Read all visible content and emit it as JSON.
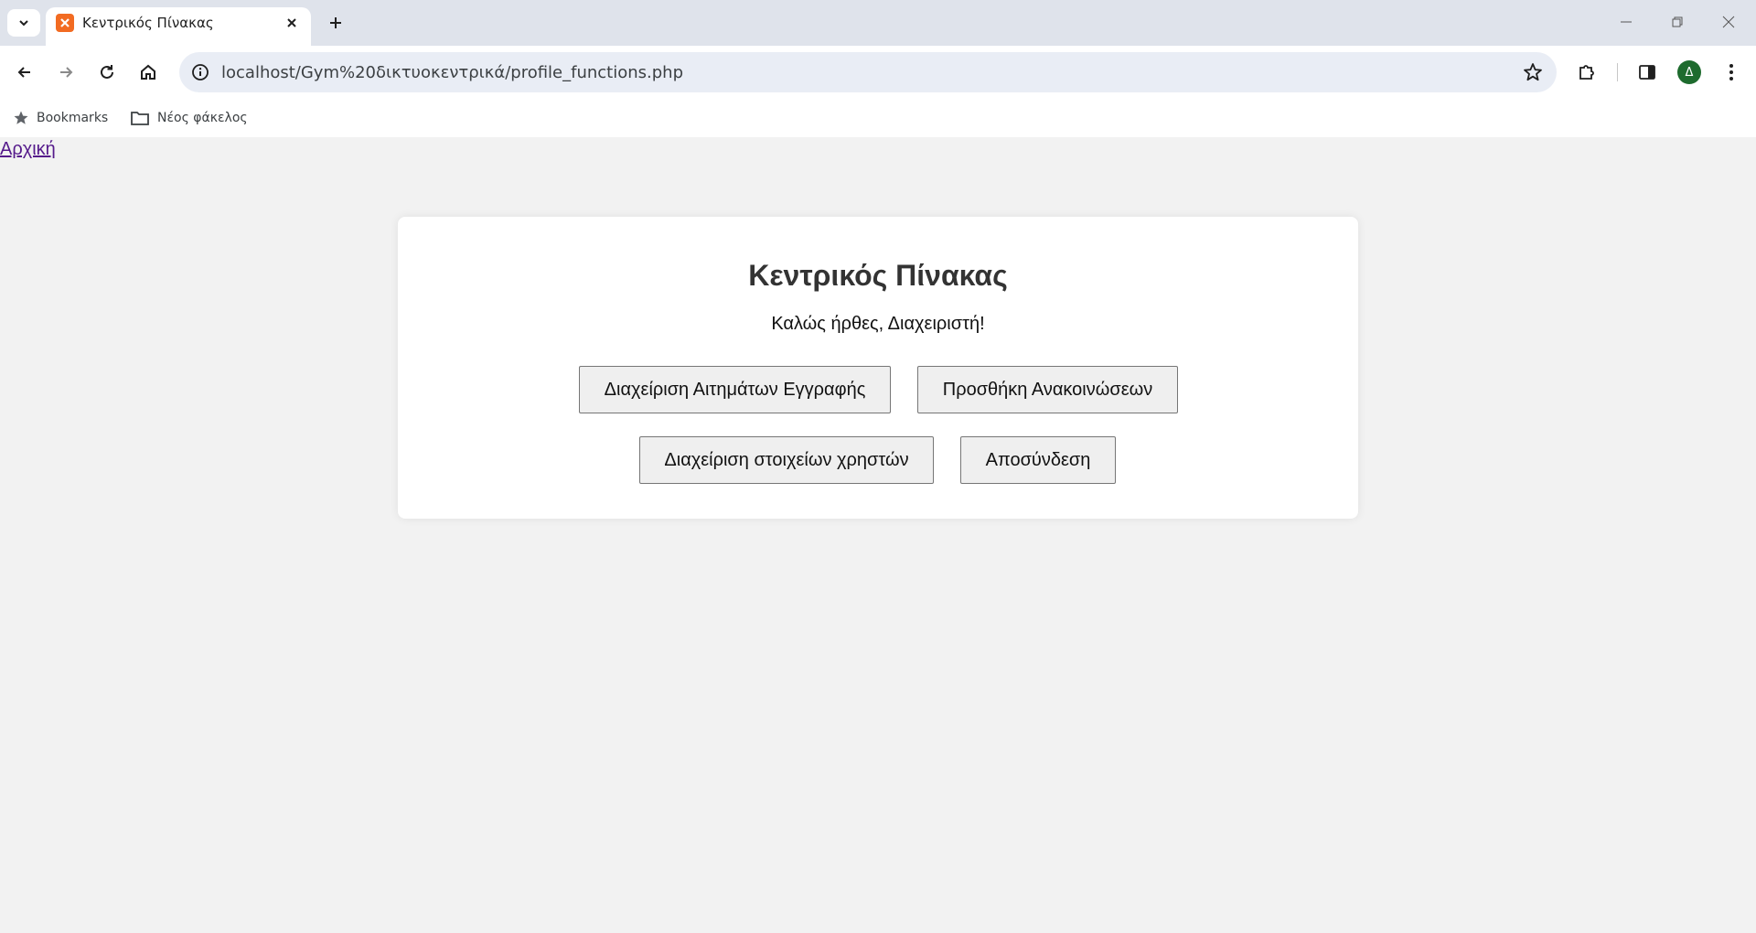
{
  "browser": {
    "tab": {
      "title": "Κεντρικός Πίνακας"
    },
    "url": "localhost/Gym%20δικτυοκεντρικά/profile_functions.php",
    "profile_initial": "Δ",
    "bookmarks": [
      {
        "label": "Bookmarks",
        "icon": "star-icon"
      },
      {
        "label": "Νέος φάκελος",
        "icon": "folder-icon"
      }
    ]
  },
  "page": {
    "home_link": "Αρχική",
    "title": "Κεντρικός Πίνακας",
    "welcome": "Καλώς ήρθες, Διαχειριστή!",
    "buttons": {
      "manage_requests": "Διαχείριση Αιτημάτων Εγγραφής",
      "add_announcements": "Προσθήκη Ανακοινώσεων",
      "manage_users": "Διαχείριση στοιχείων χρηστών",
      "logout": "Αποσύνδεση"
    }
  },
  "colors": {
    "page_bg": "#f2f2f2",
    "panel_bg": "#ffffff",
    "link_visited": "#551a8b",
    "favicon": "#f26b22",
    "avatar": "#1e6b2e"
  }
}
